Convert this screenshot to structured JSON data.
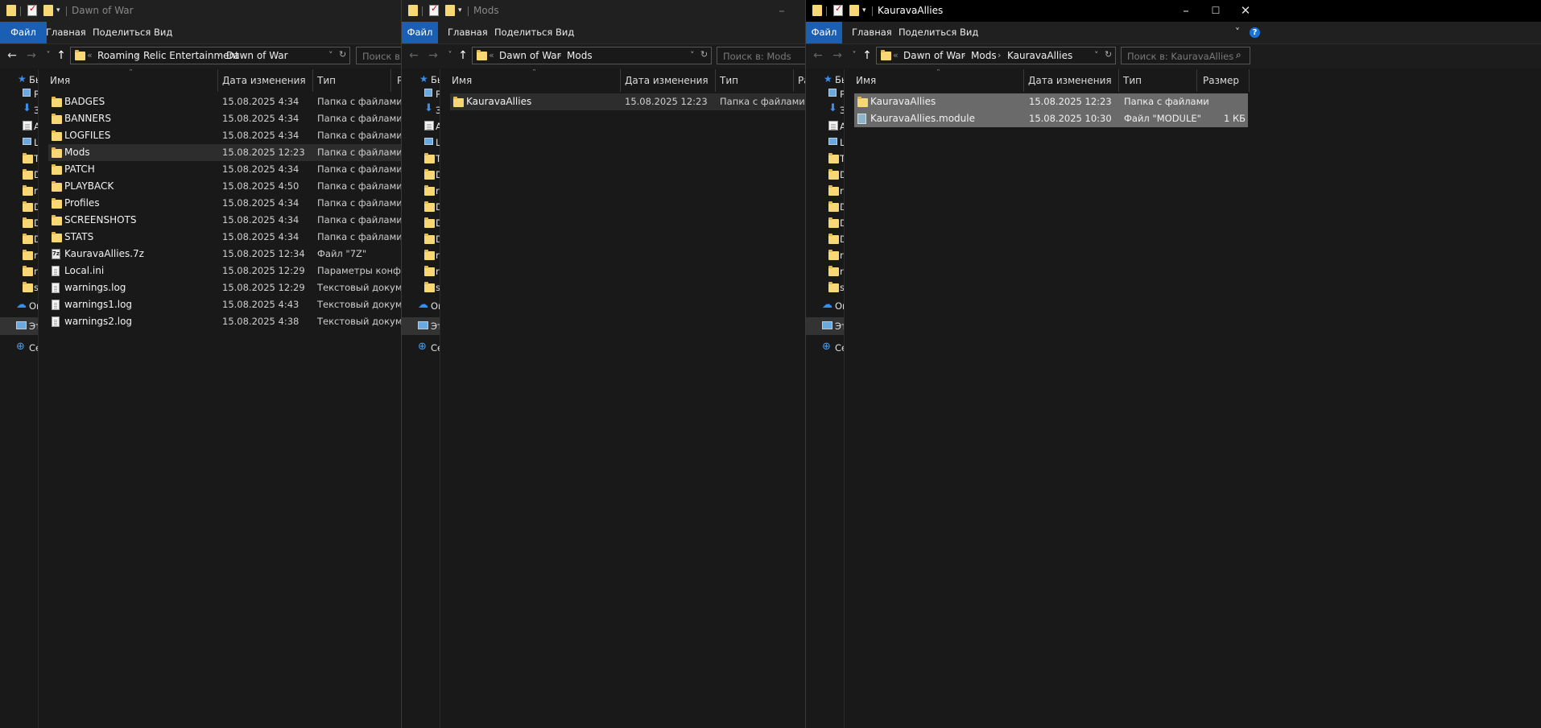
{
  "windows": [
    {
      "title": "Dawn of War",
      "ribbon": [
        "Файл",
        "Главная",
        "Поделиться",
        "Вид"
      ],
      "breadcrumb": [
        "Roaming",
        "Relic Entertainment",
        "Dawn of War"
      ],
      "search_placeholder": "Поиск в: D",
      "columns": [
        "Имя",
        "Дата изменения",
        "Тип",
        "Р"
      ],
      "sidebar": [
        "Бы",
        "Р",
        "З",
        "А",
        "L",
        "Т",
        "D",
        "r",
        "D",
        "D",
        "D",
        "r",
        "r",
        "s",
        "On",
        "Эт",
        "Се"
      ],
      "files": [
        {
          "name": "BADGES",
          "date": "15.08.2025 4:34",
          "type": "Папка с файлами",
          "icon": "folder-icon"
        },
        {
          "name": "BANNERS",
          "date": "15.08.2025 4:34",
          "type": "Папка с файлами",
          "icon": "folder-icon"
        },
        {
          "name": "LOGFILES",
          "date": "15.08.2025 4:34",
          "type": "Папка с файлами",
          "icon": "folder-icon"
        },
        {
          "name": "Mods",
          "date": "15.08.2025 12:23",
          "type": "Папка с файлами",
          "icon": "folder-icon"
        },
        {
          "name": "PATCH",
          "date": "15.08.2025 4:34",
          "type": "Папка с файлами",
          "icon": "folder-icon"
        },
        {
          "name": "PLAYBACK",
          "date": "15.08.2025 4:50",
          "type": "Папка с файлами",
          "icon": "folder-icon"
        },
        {
          "name": "Profiles",
          "date": "15.08.2025 4:34",
          "type": "Папка с файлами",
          "icon": "folder-icon"
        },
        {
          "name": "SCREENSHOTS",
          "date": "15.08.2025 4:34",
          "type": "Папка с файлами",
          "icon": "folder-icon"
        },
        {
          "name": "STATS",
          "date": "15.08.2025 4:34",
          "type": "Папка с файлами",
          "icon": "folder-icon"
        },
        {
          "name": "KauravaAllies.7z",
          "date": "15.08.2025 12:34",
          "type": "Файл \"7Z\"",
          "icon": "archive-icon"
        },
        {
          "name": "Local.ini",
          "date": "15.08.2025 12:29",
          "type": "Параметры конф...",
          "icon": "document-icon"
        },
        {
          "name": "warnings.log",
          "date": "15.08.2025 12:29",
          "type": "Текстовый докум...",
          "icon": "document-icon"
        },
        {
          "name": "warnings1.log",
          "date": "15.08.2025 4:43",
          "type": "Текстовый докум...",
          "icon": "document-icon"
        },
        {
          "name": "warnings2.log",
          "date": "15.08.2025 4:38",
          "type": "Текстовый докум...",
          "icon": "document-icon"
        }
      ]
    },
    {
      "title": "Mods",
      "ribbon": [
        "Файл",
        "Главная",
        "Поделиться",
        "Вид"
      ],
      "breadcrumb": [
        "Dawn of War",
        "Mods"
      ],
      "search_placeholder": "Поиск в: Mods",
      "columns": [
        "Имя",
        "Дата изменения",
        "Тип",
        "Ра"
      ],
      "sidebar": [
        "Бы",
        "Р",
        "З",
        "А",
        "L",
        "Т",
        "D",
        "r",
        "D",
        "D",
        "D",
        "r",
        "r",
        "s",
        "On",
        "Эт",
        "Се"
      ],
      "files": [
        {
          "name": "KauravaAllies",
          "date": "15.08.2025 12:23",
          "type": "Папка с файлами",
          "icon": "folder-icon"
        }
      ]
    },
    {
      "title": "KauravaAllies",
      "ribbon": [
        "Файл",
        "Главная",
        "Поделиться",
        "Вид"
      ],
      "breadcrumb": [
        "Dawn of War",
        "Mods",
        "KauravaAllies"
      ],
      "search_placeholder": "Поиск в: KauravaAllies",
      "columns": [
        "Имя",
        "Дата изменения",
        "Тип",
        "Размер"
      ],
      "sidebar": [
        "Бы",
        "Р",
        "З",
        "А",
        "L",
        "Т",
        "D",
        "r",
        "D",
        "D",
        "D",
        "r",
        "r",
        "s",
        "On",
        "Эт",
        "Се"
      ],
      "files": [
        {
          "name": "KauravaAllies",
          "date": "15.08.2025 12:23",
          "type": "Папка с файлами",
          "size": "",
          "icon": "folder-icon"
        },
        {
          "name": "KauravaAllies.module",
          "date": "15.08.2025 10:30",
          "type": "Файл \"MODULE\"",
          "size": "1 КБ",
          "icon": "module-file-icon"
        }
      ]
    }
  ]
}
